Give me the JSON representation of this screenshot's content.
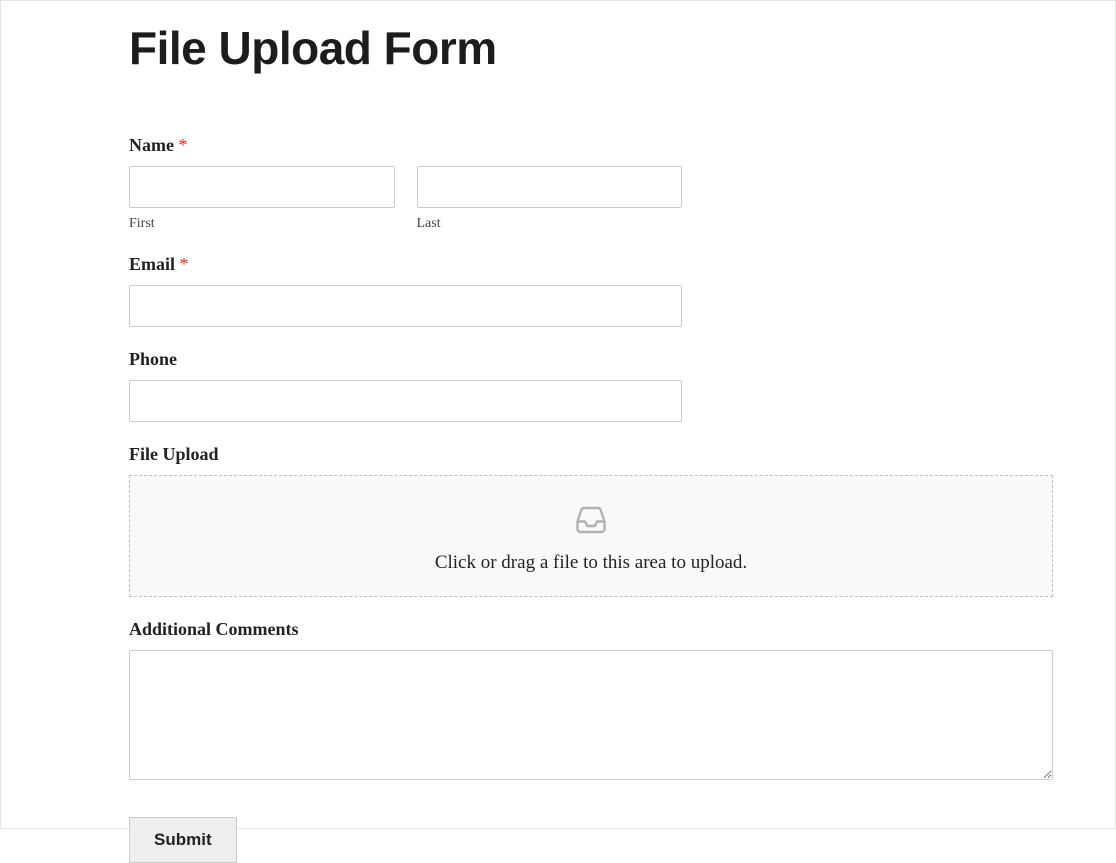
{
  "form": {
    "title": "File Upload Form",
    "name": {
      "label": "Name",
      "required_marker": "*",
      "first_sublabel": "First",
      "last_sublabel": "Last",
      "first_value": "",
      "last_value": ""
    },
    "email": {
      "label": "Email",
      "required_marker": "*",
      "value": ""
    },
    "phone": {
      "label": "Phone",
      "value": ""
    },
    "file_upload": {
      "label": "File Upload",
      "dropzone_text": "Click or drag a file to this area to upload."
    },
    "comments": {
      "label": "Additional Comments",
      "value": ""
    },
    "submit_label": "Submit"
  }
}
